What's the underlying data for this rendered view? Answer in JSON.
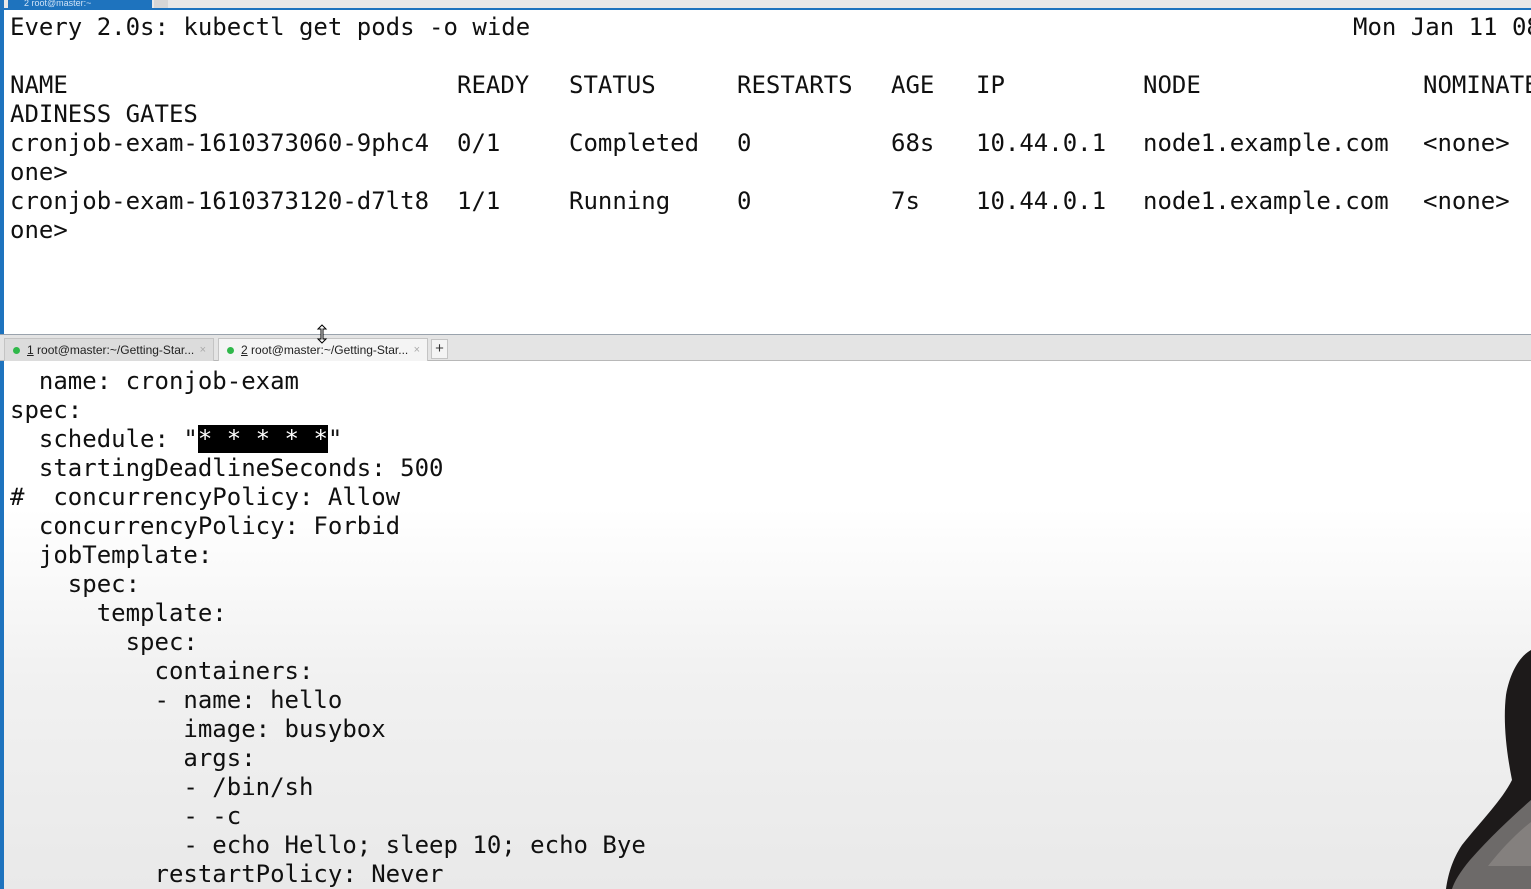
{
  "top_pane": {
    "window_tab": "2 root@master:~",
    "watch_header": "Every 2.0s: kubectl get pods -o wide",
    "timestamp": "Mon Jan 11 08",
    "headers": {
      "name": "NAME",
      "ready": "READY",
      "status": "STATUS",
      "restarts": "RESTARTS",
      "age": "AGE",
      "ip": "IP",
      "node": "NODE",
      "nominated": "NOMINATE"
    },
    "header_wrap": "ADINESS GATES",
    "rows": [
      {
        "name": "cronjob-exam-1610373060-9phc4",
        "ready": "0/1",
        "status": "Completed",
        "restarts": "0",
        "age": "68s",
        "ip": "10.44.0.1",
        "node": "node1.example.com",
        "nominated": "<none>",
        "wrap": "one>"
      },
      {
        "name": "cronjob-exam-1610373120-d7lt8",
        "ready": "1/1",
        "status": "Running",
        "restarts": "0",
        "age": "7s",
        "ip": "10.44.0.1",
        "node": "node1.example.com",
        "nominated": "<none>",
        "wrap": "one>"
      }
    ]
  },
  "tabs": [
    {
      "num": "1",
      "label": " root@master:~/Getting-Star...",
      "close": "×"
    },
    {
      "num": "2",
      "label": " root@master:~/Getting-Star...",
      "close": "×"
    }
  ],
  "add_tab": "+",
  "editor": {
    "lines": [
      "  name: cronjob-exam",
      "spec:",
      "  schedule: \"",
      "  startingDeadlineSeconds: 500",
      "#  concurrencyPolicy: Allow",
      "  concurrencyPolicy: Forbid",
      "  jobTemplate:",
      "    spec:",
      "      template:",
      "        spec:",
      "          containers:",
      "          - name: hello",
      "            image: busybox",
      "            args:",
      "            - /bin/sh",
      "            - -c",
      "            - echo Hello; sleep 10; echo Bye",
      "          restartPolicy: Never"
    ],
    "schedule_selected": "* * * * *",
    "schedule_close": "\""
  },
  "colors": {
    "accent": "#1e73be",
    "status_dot": "#2fb84a",
    "selection_bg": "#000000"
  }
}
